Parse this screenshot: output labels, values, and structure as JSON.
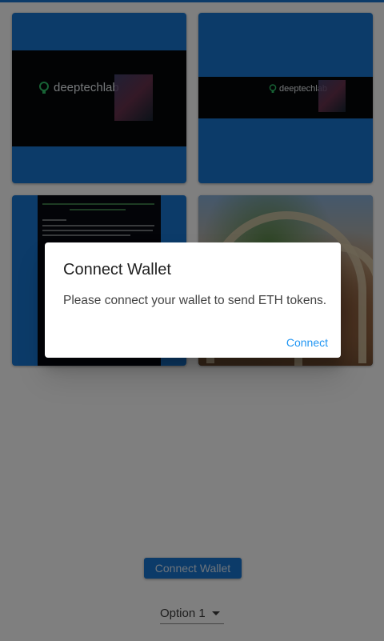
{
  "brand": "deeptechlab",
  "brand_color": "#1976d2",
  "dialog": {
    "title": "Connect Wallet",
    "message": "Please connect your wallet to send ETH tokens.",
    "action_label": "Connect"
  },
  "main_button_label": "Connect Wallet",
  "select": {
    "value": "Option 1"
  },
  "icons": {
    "logo": "lightbulb-icon",
    "dropdown": "caret-down-icon"
  }
}
